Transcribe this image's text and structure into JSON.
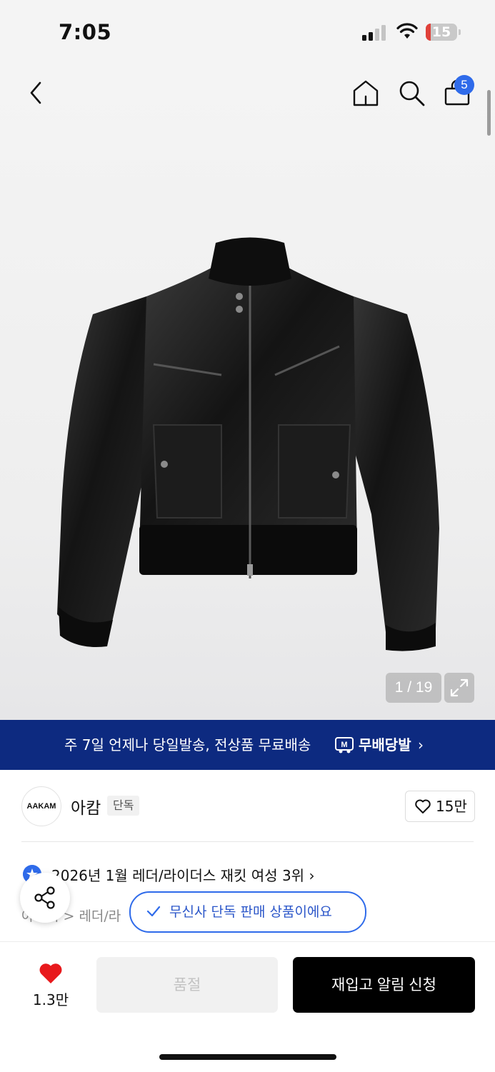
{
  "status_bar": {
    "time": "7:05",
    "battery_level": "15",
    "battery_fraction": 0.15,
    "battery_color": "#e0413a",
    "icons": [
      "signal-icon",
      "wifi-icon",
      "battery-icon"
    ]
  },
  "nav": {
    "icons": [
      "back-chevron-icon",
      "home-icon",
      "search-icon",
      "cart-icon"
    ],
    "cart_count": "5"
  },
  "gallery": {
    "counter": "1 / 19",
    "expand_icon": "expand-icon",
    "product_image": "black leather bomber jacket"
  },
  "banner": {
    "text": "주 7일 언제나 당일발송, 전상품 무료배송",
    "brand": "무배당발",
    "logo_icon": "m-delivery-icon",
    "background": "#0d2a80"
  },
  "brand": {
    "logo_text": "AAKAM",
    "name": "아캄",
    "tag": "단독",
    "likes": "15만"
  },
  "ranking": {
    "text": "2026년 1월 레더/라이더스 재킷 여성 3위",
    "breadcrumb": "아우터 > 레더/라"
  },
  "toast": {
    "text": "무신사 단독 판매 상품이에요",
    "accent": "#2f6bea"
  },
  "actions": {
    "wish_count": "1.3만",
    "soldout_label": "품절",
    "restock_label": "재입고 알림 신청",
    "heart_color": "#e8191c"
  }
}
